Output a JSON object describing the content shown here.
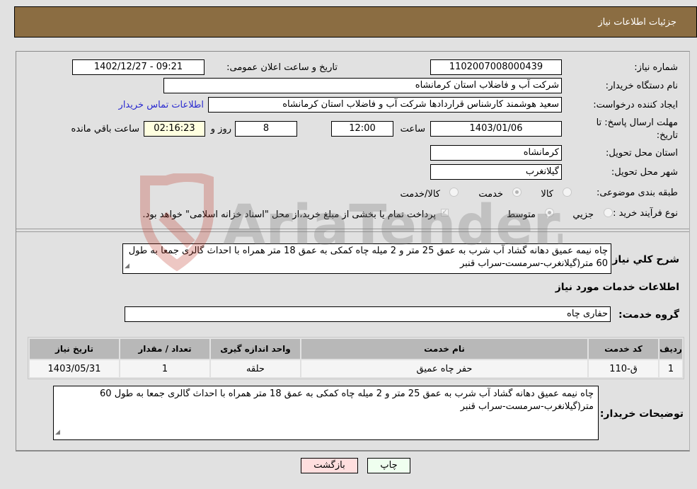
{
  "header": {
    "title": "جزئیات اطلاعات نیاز"
  },
  "fields": {
    "need_number": {
      "label": "شماره نیاز:",
      "value": "1102007008000439"
    },
    "announce_datetime": {
      "label": "تاریخ و ساعت اعلان عمومی:",
      "value": "1402/12/27 - 09:21"
    },
    "buyer_org": {
      "label": "نام دستگاه خریدار:",
      "value": "شرکت آب و فاضلاب استان کرمانشاه"
    },
    "requester": {
      "label": "ایجاد کننده درخواست:",
      "value": "سعید هوشمند کارشناس قراردادها شرکت آب و فاضلاب استان کرمانشاه"
    },
    "contact_link": "اطلاعات تماس خریدار",
    "deadline": {
      "label": "مهلت ارسال پاسخ: تا تاریخ:",
      "date": "1403/01/06",
      "time_label": "ساعت",
      "time": "12:00",
      "days": "8",
      "days_label": "روز و",
      "remaining": "02:16:23",
      "remaining_label": "ساعت باقي مانده"
    },
    "province": {
      "label": "استان محل تحویل:",
      "value": "کرمانشاه"
    },
    "city": {
      "label": "شهر محل تحویل:",
      "value": "گیلانغرب"
    },
    "category": {
      "label": "طبقه بندی موضوعی:",
      "options": [
        "کالا",
        "خدمت",
        "کالا/خدمت"
      ],
      "selected": "خدمت"
    },
    "purchase_type": {
      "label": "نوع فرآیند خرید :",
      "options": [
        "جزيي",
        "متوسط"
      ],
      "selected": "متوسط",
      "treasury_note": "پرداخت تمام یا بخشی از مبلغ خرید،از محل \"اسناد خزانه اسلامی\" خواهد بود.",
      "treasury_checked": true
    }
  },
  "description": {
    "label": "شرح کلي نیاز:",
    "value": "چاه نیمه عمیق دهانه گشاد آب شرب به عمق 25 متر و 2 میله چاه کمکی به عمق 18 متر همراه با احداث گالری جمعا به طول 60 متر(گیلانغرب-سرمست-سراب قنبر"
  },
  "services_section": {
    "title": "اطلاعات خدمات مورد نیاز",
    "group_label": "گروه خدمت:",
    "group_value": "حفاری چاه",
    "table": {
      "headers": [
        "ردیف",
        "کد خدمت",
        "نام خدمت",
        "واحد اندازه گیری",
        "تعداد / مقدار",
        "تاریخ نیاز"
      ],
      "rows": [
        [
          "1",
          "ق-110",
          "حفر چاه عمیق",
          "حلقه",
          "1",
          "1403/05/31"
        ]
      ]
    }
  },
  "buyer_notes": {
    "label": "توضیحات خریدار:",
    "value": "چاه نیمه عمیق دهانه گشاد آب شرب به عمق 25 متر و 2 میله چاه کمکی به عمق 18 متر همراه با احداث گالری جمعا به طول 60 متر(گیلانغرب-سرمست-سراب قنبر"
  },
  "buttons": {
    "print": "چاپ",
    "back": "بازگشت"
  },
  "watermark": {
    "text": "AriaTender.net"
  },
  "colors": {
    "header_bg": "#8b6d42",
    "print_bg": "#efffef",
    "back_bg": "#ffdede",
    "remaining_bg": "#ffffe0",
    "link": "#2a2ad0"
  }
}
